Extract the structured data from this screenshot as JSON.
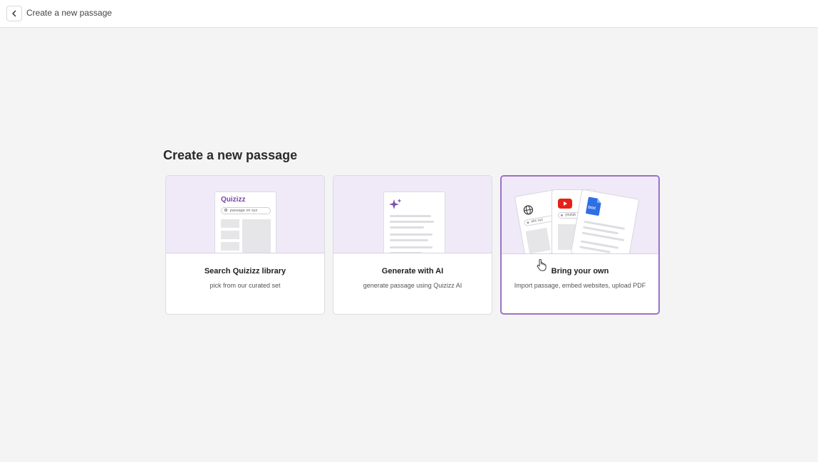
{
  "header": {
    "title": "Create a new passage",
    "back_icon": "chevron-left-icon"
  },
  "main": {
    "heading": "Create a new passage",
    "cards": [
      {
        "title": "Search Quizizz library",
        "subtitle": "pick from our curated set",
        "illustration": {
          "logo": "Quizizz",
          "search_placeholder": "passage on xyz"
        }
      },
      {
        "title": "Generate with AI",
        "subtitle": "generate passage using Quizizz AI",
        "illustration": {
          "icon": "sparkle-icon"
        }
      },
      {
        "title": "Bring your own",
        "subtitle": "Import passage, embed websites, upload PDF",
        "selected": true,
        "illustration": {
          "web_url": "abc.xyz",
          "video_url": "youtub",
          "doc_badge": "DOC"
        }
      }
    ]
  },
  "colors": {
    "accent_purple": "#9b72c8",
    "illustration_bg": "#efe9f8",
    "youtube_red": "#e62117",
    "doc_blue": "#2f6fe4"
  }
}
